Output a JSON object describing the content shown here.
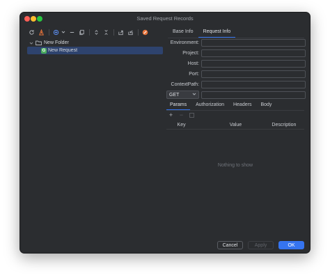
{
  "window": {
    "title": "Saved Request Records"
  },
  "toolbar": {
    "icons": [
      "refresh-icon",
      "export-curl-icon",
      "add-icon",
      "dropdown-icon",
      "remove-icon",
      "copy-icon",
      "expand-all-icon",
      "collapse-all-icon",
      "export-icon",
      "import-icon",
      "no-entry-icon"
    ]
  },
  "tree": {
    "folder_label": "New Folder",
    "request_label": "New Request",
    "request_icon_letter": "G"
  },
  "tabs": {
    "base_info": "Base Info",
    "request_info": "Request Info"
  },
  "form": {
    "environment_label": "Environment:",
    "project_label": "Project:",
    "host_label": "Host:",
    "port_label": "Port:",
    "context_path_label": "ContextPath:",
    "environment_value": "",
    "project_value": "",
    "host_value": "",
    "port_value": "",
    "context_path_value": ""
  },
  "request": {
    "method": "GET",
    "url": ""
  },
  "sub_tabs": {
    "params": "Params",
    "authorization": "Authorization",
    "headers": "Headers",
    "body": "Body"
  },
  "table": {
    "add": "+",
    "remove": "−",
    "columns": [
      "Key",
      "Value",
      "Description"
    ],
    "empty_text": "Nothing to show"
  },
  "buttons": {
    "cancel": "Cancel",
    "apply": "Apply",
    "ok": "OK"
  },
  "colors": {
    "accent": "#3574f0",
    "background": "#2b2d30",
    "selection": "#2e436e"
  }
}
